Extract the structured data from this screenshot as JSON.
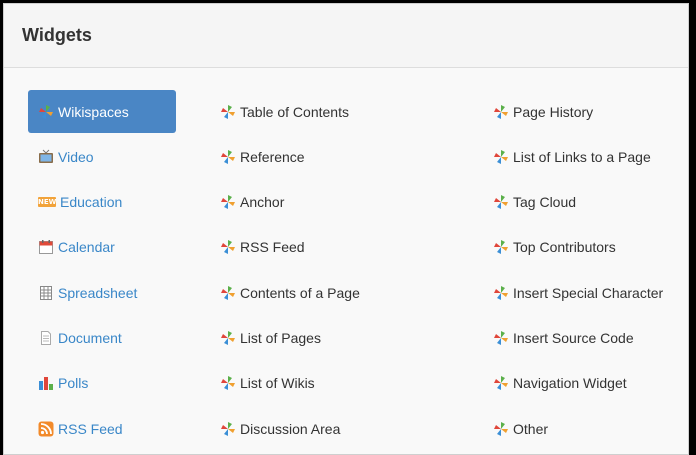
{
  "dialog": {
    "title": "Widgets"
  },
  "colors": {
    "active_bg": "#4a86c5",
    "link_blue": "#3a87c8",
    "text_dark": "#333333",
    "pinwheel_red": "#e0463a",
    "pinwheel_green": "#5bb04a",
    "pinwheel_blue": "#3b8fd6",
    "pinwheel_orange": "#f0a030"
  },
  "categories": [
    {
      "label": "Wikispaces",
      "icon": "pinwheel-icon",
      "active": true
    },
    {
      "label": "Video",
      "icon": "tv-icon",
      "active": false
    },
    {
      "label": "Education",
      "icon": "new-badge-icon",
      "badge": "NEW",
      "active": false
    },
    {
      "label": "Calendar",
      "icon": "calendar-icon",
      "active": false
    },
    {
      "label": "Spreadsheet",
      "icon": "spreadsheet-icon",
      "active": false
    },
    {
      "label": "Document",
      "icon": "document-icon",
      "active": false
    },
    {
      "label": "Polls",
      "icon": "bar-chart-icon",
      "active": false
    },
    {
      "label": "RSS Feed",
      "icon": "rss-icon",
      "active": false
    }
  ],
  "widgets_col1": [
    {
      "label": "Table of Contents",
      "icon": "pinwheel-icon"
    },
    {
      "label": "Reference",
      "icon": "pinwheel-icon"
    },
    {
      "label": "Anchor",
      "icon": "pinwheel-icon"
    },
    {
      "label": "RSS Feed",
      "icon": "pinwheel-icon"
    },
    {
      "label": "Contents of a Page",
      "icon": "pinwheel-icon"
    },
    {
      "label": "List of Pages",
      "icon": "pinwheel-icon"
    },
    {
      "label": "List of Wikis",
      "icon": "pinwheel-icon"
    },
    {
      "label": "Discussion Area",
      "icon": "pinwheel-icon"
    }
  ],
  "widgets_col2": [
    {
      "label": "Page History",
      "icon": "pinwheel-icon"
    },
    {
      "label": "List of Links to a Page",
      "icon": "pinwheel-icon"
    },
    {
      "label": "Tag Cloud",
      "icon": "pinwheel-icon"
    },
    {
      "label": "Top Contributors",
      "icon": "pinwheel-icon"
    },
    {
      "label": "Insert Special Character",
      "icon": "pinwheel-icon"
    },
    {
      "label": "Insert Source Code",
      "icon": "pinwheel-icon"
    },
    {
      "label": "Navigation Widget",
      "icon": "pinwheel-icon"
    },
    {
      "label": "Other",
      "icon": "pinwheel-icon"
    }
  ]
}
